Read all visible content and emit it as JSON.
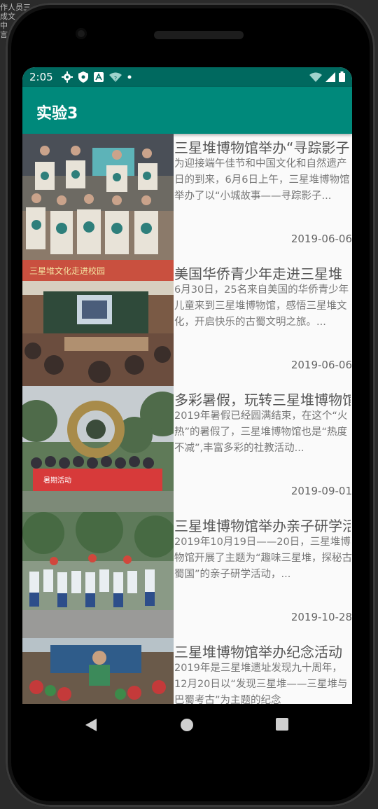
{
  "desktop_bg_text": [
    "作人员三",
    "成文",
    "中",
    "言"
  ],
  "status": {
    "time": "2:05"
  },
  "app": {
    "title": "实验3"
  },
  "items": [
    {
      "title": "三星堆博物馆举办“寻踪影子”",
      "desc": "为迎接端午佳节和中国文化和自然遗产日的到来，6月6日上午，三星堆博物馆举办了以“小城故事——寻踪影子...",
      "date": "2019-06-06"
    },
    {
      "title": "美国华侨青少年走进三星堆",
      "desc": "6月30日，25名来自美国的华侨青少年儿童来到三星堆博物馆，感悟三星堆文化，开启快乐的古蜀文明之旅。...",
      "date": "2019-06-06"
    },
    {
      "title": "多彩暑假，玩转三星堆博物馆",
      "desc": "2019年暑假已经圆满结束，在这个“火热”的暑假了，三星堆博物馆也是“热度不减”,丰富多彩的社教活动...",
      "date": "2019-09-01"
    },
    {
      "title": "三星堆博物馆举办亲子研学活动",
      "desc": "2019年10月19日——20日，三星堆博物馆开展了主题为“趣味三星堆，探秘古蜀国”的亲子研学活动，...",
      "date": "2019-10-28"
    },
    {
      "title": "三星堆博物馆举办纪念活动",
      "desc": "2019年是三星堆遗址发现九十周年，12月20日以“发现三星堆——三星堆与巴蜀考古”为主题的纪念",
      "date": ""
    }
  ]
}
